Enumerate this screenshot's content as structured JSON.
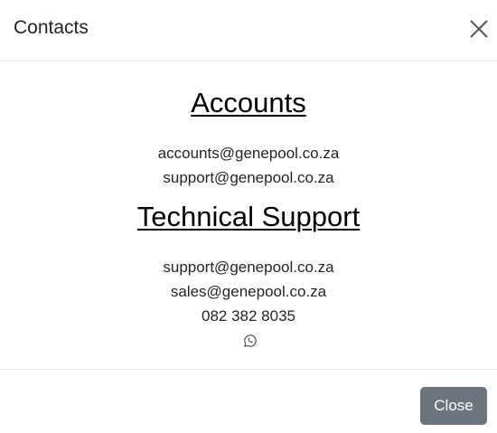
{
  "modal": {
    "title": "Contacts",
    "close_icon": "close-icon",
    "accounts": {
      "heading": "Accounts",
      "emails": [
        "accounts@genepool.co.za",
        "support@genepool.co.za"
      ]
    },
    "technical_support": {
      "heading": "Technical Support",
      "emails": [
        "support@genepool.co.za",
        "sales@genepool.co.za"
      ],
      "phone": "082 382 8035",
      "whatsapp_icon": "whatsapp-icon"
    },
    "footer": {
      "close_label": "Close"
    }
  },
  "colors": {
    "button_bg": "#6c757d",
    "button_text": "#ffffff",
    "divider": "#e9ecef",
    "heading_text": "#000000",
    "body_text": "#212529"
  }
}
